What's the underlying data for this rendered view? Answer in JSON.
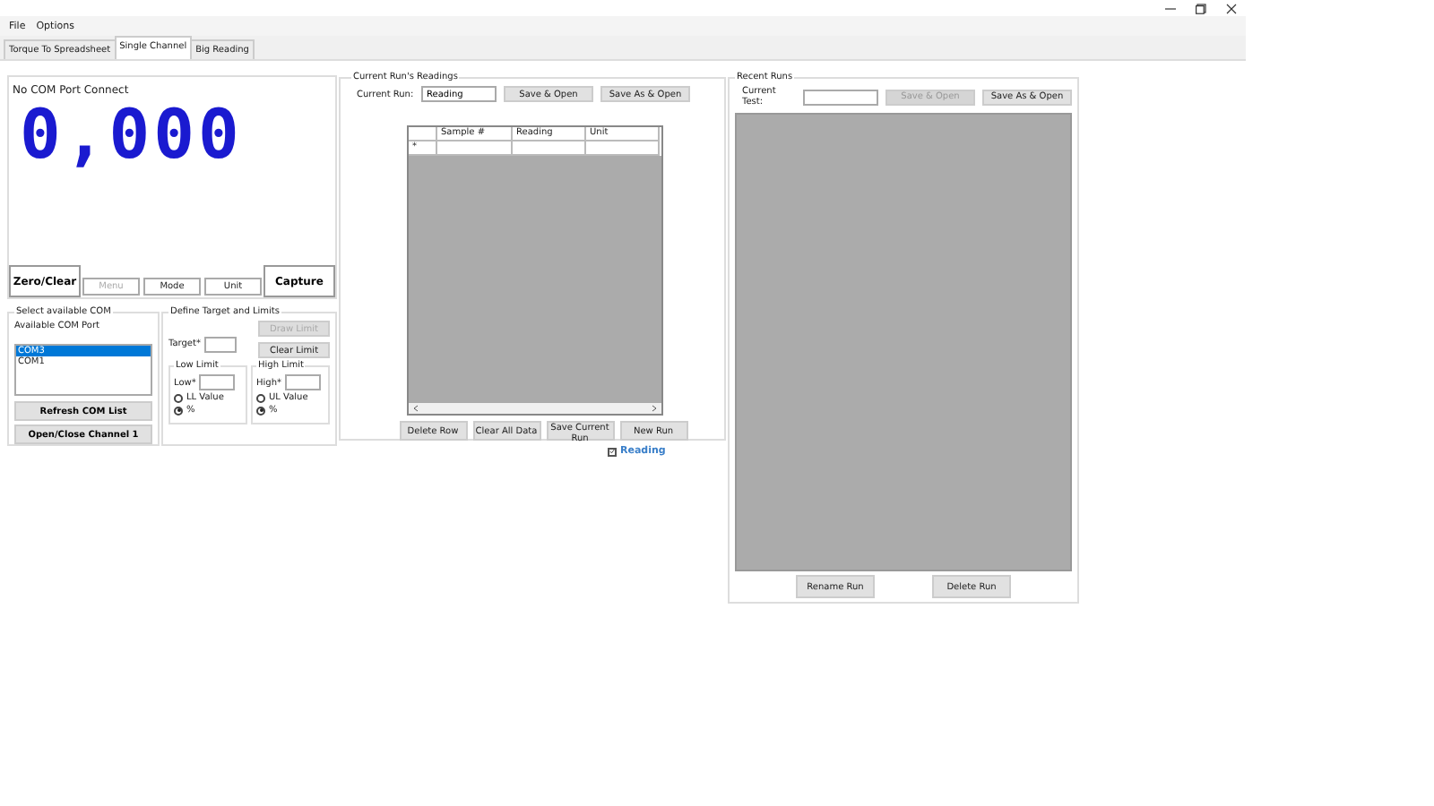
{
  "menu": [
    "File",
    "Options"
  ],
  "tabs": [
    {
      "label": "Torque To Spreadsheet",
      "selected": false
    },
    {
      "label": "Single Channel",
      "selected": true
    },
    {
      "label": "Big Reading",
      "selected": false
    }
  ],
  "display": {
    "status": "No COM Port Connect",
    "reading": "0,000",
    "zero_button": "Zero/Clear",
    "capture_button": "Capture",
    "small_buttons": [
      {
        "label": "Menu",
        "disabled": true
      },
      {
        "label": "Mode",
        "disabled": false
      },
      {
        "label": "Unit",
        "disabled": false
      }
    ]
  },
  "com": {
    "title": "Select available COM",
    "list_label": "Available COM Port",
    "ports": [
      {
        "label": "COM3",
        "selected": true
      },
      {
        "label": "COM1",
        "selected": false
      }
    ],
    "buttons": [
      "Refresh COM List",
      "Open/Close Channel 1"
    ]
  },
  "limits": {
    "title": "Define Target and Limits",
    "target_label": "Target*",
    "draw_button": {
      "label": "Draw Limit",
      "disabled": true
    },
    "clear_button": {
      "label": "Clear Limit",
      "disabled": false
    },
    "groups": [
      {
        "title": "Low Limit",
        "field_label": "Low*",
        "options": [
          {
            "label": "LL Value",
            "selected": false
          },
          {
            "label": "%",
            "selected": true
          }
        ]
      },
      {
        "title": "High Limit",
        "field_label": "High*",
        "options": [
          {
            "label": "UL Value",
            "selected": false
          },
          {
            "label": "%",
            "selected": true
          }
        ]
      }
    ]
  },
  "current_run": {
    "title": "Current Run's Readings",
    "run_label": "Current Run:",
    "run_value": "Reading",
    "buttons": [
      {
        "label": "Save & Open",
        "disabled": false
      },
      {
        "label": "Save As & Open",
        "disabled": false
      }
    ],
    "table": {
      "columns": [
        "Sample #",
        "Reading",
        "Unit"
      ],
      "new_row_marker": "*"
    },
    "actions": [
      "Delete Row",
      "Clear All Data",
      "Save Current Run",
      "New Run"
    ],
    "checkbox": {
      "label": "Reading",
      "checked": true
    }
  },
  "recent_runs": {
    "title": "Recent Runs",
    "test_label": "Current Test:",
    "buttons": [
      {
        "label": "Save & Open",
        "disabled": true
      },
      {
        "label": "Save As & Open",
        "disabled": false
      }
    ],
    "actions": [
      "Rename Run",
      "Delete Run"
    ]
  }
}
